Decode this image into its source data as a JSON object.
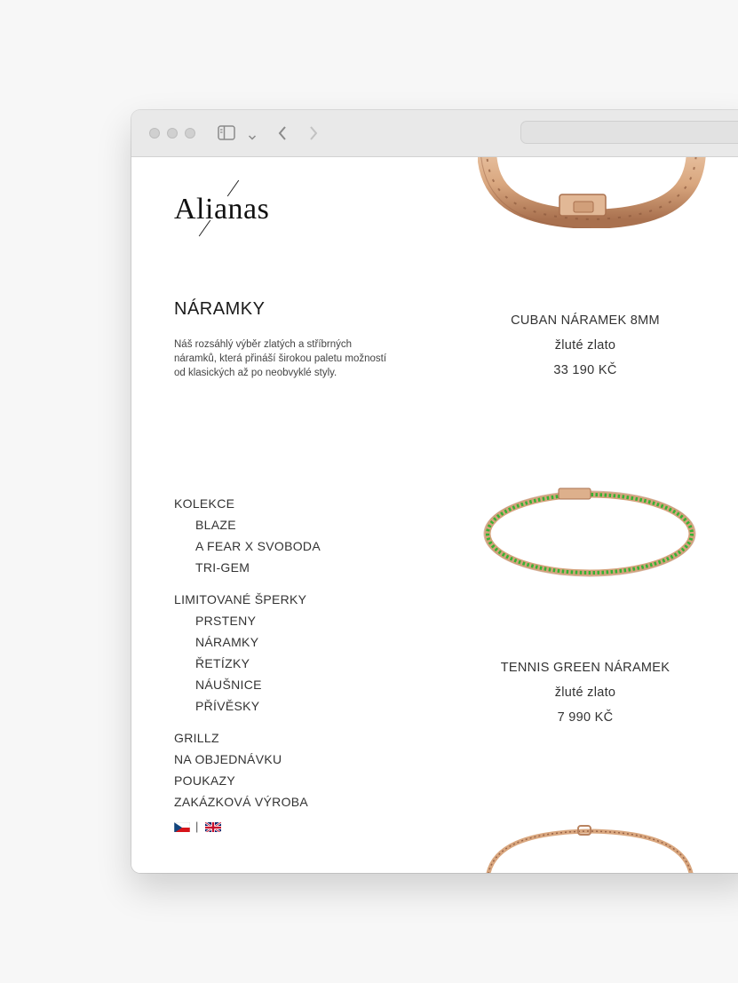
{
  "site": {
    "logo": "Alianas"
  },
  "category": {
    "title": "NÁRAMKY",
    "description": "Náš rozsáhlý výběr zlatých a stříbrných náramků, která přináší širokou paletu možností od klasických až po neobvyklé styly."
  },
  "nav": {
    "items": [
      {
        "label": "KOLEKCE",
        "level": 0
      },
      {
        "label": "BLAZE",
        "level": 1
      },
      {
        "label": "A FEAR X SVOBODA",
        "level": 1
      },
      {
        "label": "TRI-GEM",
        "level": 1
      },
      {
        "label": "LIMITOVANÉ ŠPERKY",
        "level": 0
      },
      {
        "label": "PRSTENY",
        "level": 1
      },
      {
        "label": "NÁRAMKY",
        "level": 1
      },
      {
        "label": "ŘETÍZKY",
        "level": 1
      },
      {
        "label": "NÁUŠNICE",
        "level": 1
      },
      {
        "label": "PŘÍVĚSKY",
        "level": 1
      },
      {
        "label": "GRILLZ",
        "level": 0
      },
      {
        "label": "NA OBJEDNÁVKU",
        "level": 0
      },
      {
        "label": "POUKAZY",
        "level": 0
      },
      {
        "label": "ZAKÁZKOVÁ VÝROBA",
        "level": 0
      }
    ],
    "language_separator": "|",
    "languages": [
      "cz-flag-icon",
      "uk-flag-icon"
    ]
  },
  "products": [
    {
      "name": "CUBAN NÁRAMEK 8MM",
      "material": "žluté zlato",
      "price": "33 190 KČ",
      "image": "cuban-bracelet-image"
    },
    {
      "name": "TENNIS GREEN NÁRAMEK",
      "material": "žluté zlato",
      "price": "7 990 KČ",
      "image": "tennis-green-bracelet-image"
    },
    {
      "image": "chain-bracelet-image"
    }
  ],
  "colors": {
    "gold": "#d9a77f",
    "gold_dark": "#b98360",
    "emerald": "#37b233"
  }
}
